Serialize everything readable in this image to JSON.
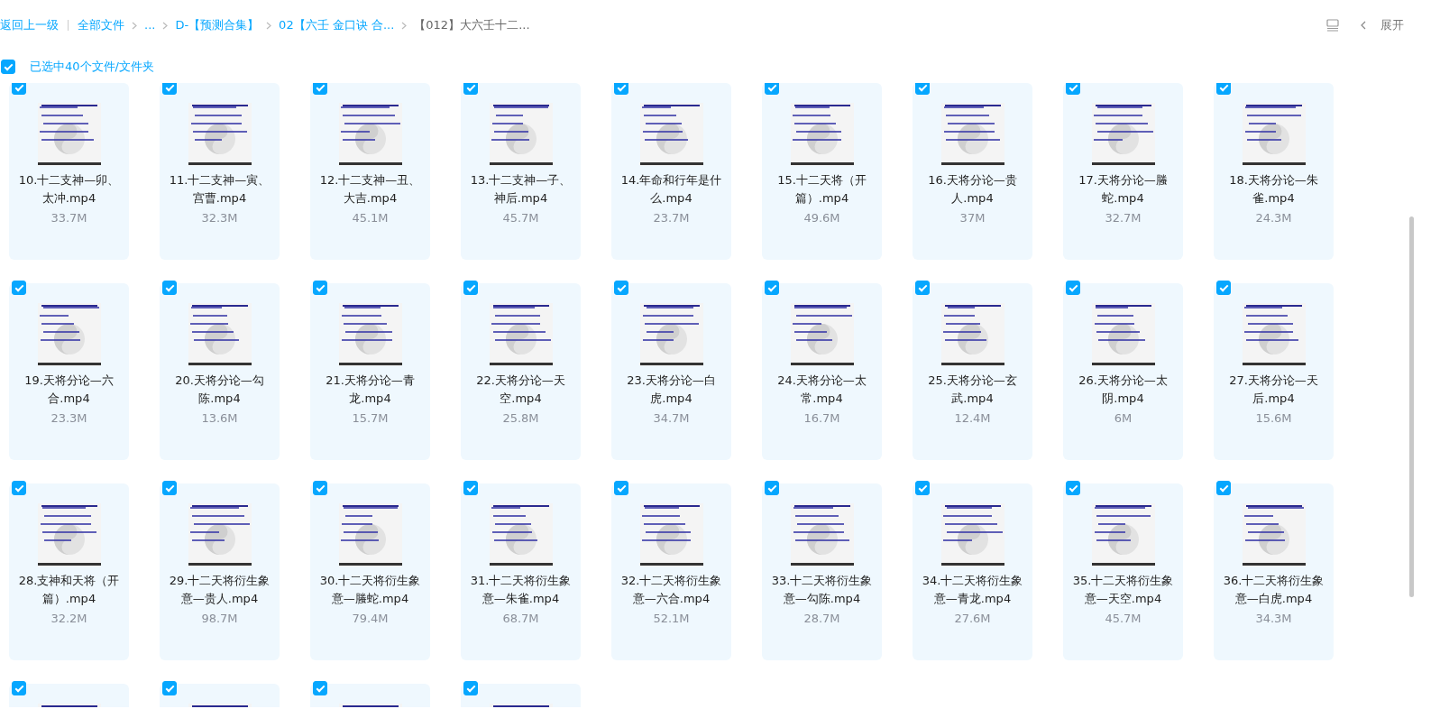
{
  "breadcrumb": {
    "back": "返回上一级",
    "items": [
      {
        "label": "全部文件",
        "current": false
      },
      {
        "label": "...",
        "current": false
      },
      {
        "label": "D-【预测合集】",
        "current": false
      },
      {
        "label": "02【六壬 金口诀 合...",
        "current": false
      },
      {
        "label": "【012】大六壬十二...",
        "current": true
      }
    ]
  },
  "toolbar": {
    "expand": "展开"
  },
  "selection": {
    "checked": true,
    "label": "已选中40个文件/文件夹"
  },
  "files": [
    {
      "name": "10.十二支神—卯、太冲.mp4",
      "size": "33.7M",
      "selected": true
    },
    {
      "name": "11.十二支神—寅、宫曹.mp4",
      "size": "32.3M",
      "selected": true
    },
    {
      "name": "12.十二支神—丑、大吉.mp4",
      "size": "45.1M",
      "selected": true
    },
    {
      "name": "13.十二支神—子、神后.mp4",
      "size": "45.7M",
      "selected": true
    },
    {
      "name": "14.年命和行年是什么.mp4",
      "size": "23.7M",
      "selected": true
    },
    {
      "name": "15.十二天将（开篇）.mp4",
      "size": "49.6M",
      "selected": true
    },
    {
      "name": "16.天将分论—贵人.mp4",
      "size": "37M",
      "selected": true
    },
    {
      "name": "17.天将分论—螣蛇.mp4",
      "size": "32.7M",
      "selected": true
    },
    {
      "name": "18.天将分论—朱雀.mp4",
      "size": "24.3M",
      "selected": true
    },
    {
      "name": "19.天将分论—六合.mp4",
      "size": "23.3M",
      "selected": true
    },
    {
      "name": "20.天将分论—勾陈.mp4",
      "size": "13.6M",
      "selected": true
    },
    {
      "name": "21.天将分论—青龙.mp4",
      "size": "15.7M",
      "selected": true
    },
    {
      "name": "22.天将分论—天空.mp4",
      "size": "25.8M",
      "selected": true
    },
    {
      "name": "23.天将分论—白虎.mp4",
      "size": "34.7M",
      "selected": true
    },
    {
      "name": "24.天将分论—太常.mp4",
      "size": "16.7M",
      "selected": true
    },
    {
      "name": "25.天将分论—玄武.mp4",
      "size": "12.4M",
      "selected": true
    },
    {
      "name": "26.天将分论—太阴.mp4",
      "size": "6M",
      "selected": true
    },
    {
      "name": "27.天将分论—天后.mp4",
      "size": "15.6M",
      "selected": true
    },
    {
      "name": "28.支神和天将（开篇）.mp4",
      "size": "32.2M",
      "selected": true
    },
    {
      "name": "29.十二天将衍生象意—贵人.mp4",
      "size": "98.7M",
      "selected": true
    },
    {
      "name": "30.十二天将衍生象意—螣蛇.mp4",
      "size": "79.4M",
      "selected": true
    },
    {
      "name": "31.十二天将衍生象意—朱雀.mp4",
      "size": "68.7M",
      "selected": true
    },
    {
      "name": "32.十二天将衍生象意—六合.mp4",
      "size": "52.1M",
      "selected": true
    },
    {
      "name": "33.十二天将衍生象意—勾陈.mp4",
      "size": "28.7M",
      "selected": true
    },
    {
      "name": "34.十二天将衍生象意—青龙.mp4",
      "size": "27.6M",
      "selected": true
    },
    {
      "name": "35.十二天将衍生象意—天空.mp4",
      "size": "45.7M",
      "selected": true
    },
    {
      "name": "36.十二天将衍生象意—白虎.mp4",
      "size": "34.3M",
      "selected": true
    },
    {
      "selected": true
    },
    {
      "selected": true
    },
    {
      "selected": true
    },
    {
      "selected": true
    }
  ]
}
